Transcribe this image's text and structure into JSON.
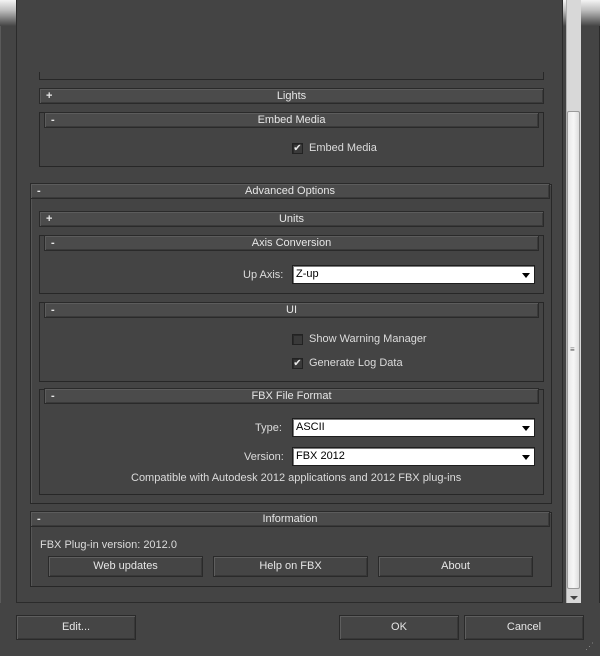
{
  "rollouts": {
    "lights": {
      "sign": "+",
      "title": "Lights"
    },
    "embed_media": {
      "sign": "-",
      "title": "Embed Media",
      "checkbox_label": "Embed Media",
      "checked": true
    },
    "advanced_options": {
      "sign": "-",
      "title": "Advanced Options"
    },
    "units": {
      "sign": "+",
      "title": "Units"
    },
    "axis_conversion": {
      "sign": "-",
      "title": "Axis Conversion",
      "up_axis_label": "Up Axis:",
      "up_axis_value": "Z-up"
    },
    "ui": {
      "sign": "-",
      "title": "UI",
      "show_warning_label": "Show Warning Manager",
      "show_warning_checked": false,
      "generate_log_label": "Generate Log Data",
      "generate_log_checked": true
    },
    "fbx_file_format": {
      "sign": "-",
      "title": "FBX File Format",
      "type_label": "Type:",
      "type_value": "ASCII",
      "version_label": "Version:",
      "version_value": "FBX 2012",
      "compat_text": "Compatible with Autodesk 2012 applications and 2012 FBX plug-ins"
    },
    "information": {
      "sign": "-",
      "title": "Information",
      "plugin_version": "FBX Plug-in version: 2012.0",
      "web_updates": "Web updates",
      "help": "Help on FBX",
      "about": "About"
    }
  },
  "footer": {
    "edit": "Edit...",
    "ok": "OK",
    "cancel": "Cancel"
  },
  "check_glyph": "✔",
  "grip_glyph": "≡",
  "resize_glyph": "⋰"
}
